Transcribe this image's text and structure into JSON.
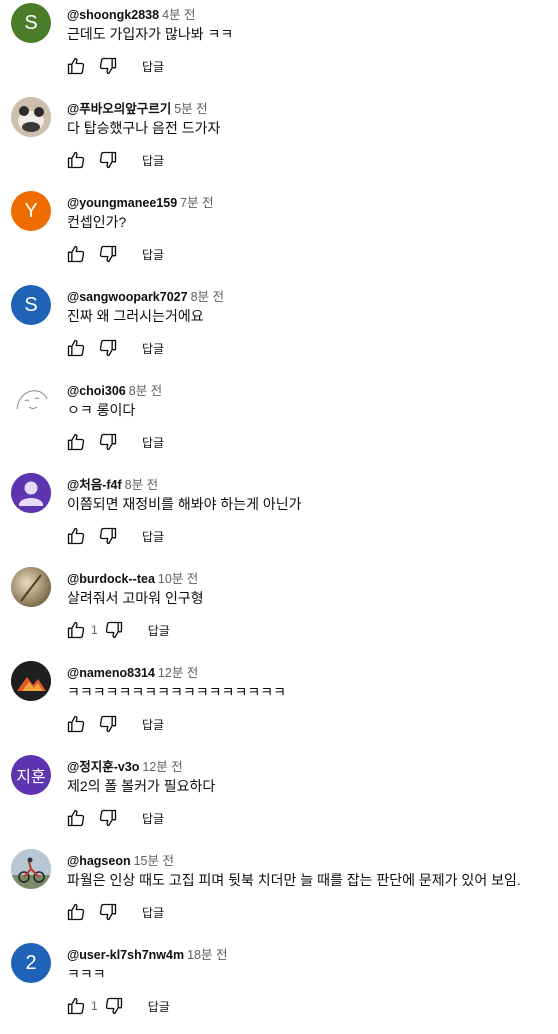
{
  "comments": [
    {
      "author": "@shoongk2838",
      "time": "4분 전",
      "text": "근데도 가입자가 많나봐 ㅋㅋ",
      "avatar": {
        "letter": "S",
        "color": "#4a7c2a",
        "kind": "letter"
      },
      "likes": "",
      "reply": "답글"
    },
    {
      "author": "@푸바오의앞구르기",
      "time": "5분 전",
      "text": "다 탑승했구나 음전 드가자",
      "avatar": {
        "letter": "",
        "color": "#bfb3a3",
        "kind": "photo-panda-icon"
      },
      "likes": "",
      "reply": "답글"
    },
    {
      "author": "@youngmanee159",
      "time": "7분 전",
      "text": "컨셉인가?",
      "avatar": {
        "letter": "Y",
        "color": "#ef6c00",
        "kind": "letter"
      },
      "likes": "",
      "reply": "답글"
    },
    {
      "author": "@sangwoopark7027",
      "time": "8분 전",
      "text": "진짜 왜 그러시는거에요",
      "avatar": {
        "letter": "S",
        "color": "#1e63b8",
        "kind": "letter"
      },
      "likes": "",
      "reply": "답글"
    },
    {
      "author": "@choi306",
      "time": "8분 전",
      "text": "ㅇㅋ 롱이다",
      "avatar": {
        "letter": "",
        "color": "#ffffff",
        "kind": "sketch-face-icon"
      },
      "likes": "",
      "reply": "답글"
    },
    {
      "author": "@처음-f4f",
      "time": "8분 전",
      "text": "이쯤되면 재정비를 해봐야 하는게 아닌가",
      "avatar": {
        "letter": "",
        "color": "#5e35b1",
        "kind": "default-user-icon"
      },
      "likes": "",
      "reply": "답글"
    },
    {
      "author": "@burdock--tea",
      "time": "10분 전",
      "text": "살려줘서 고마워 인구형",
      "avatar": {
        "letter": "",
        "color": "#a08b60",
        "kind": "photo-tea-icon"
      },
      "likes": "1",
      "reply": "답글"
    },
    {
      "author": "@nameno8314",
      "time": "12분 전",
      "text": "ㅋㅋㅋㅋㅋㅋㅋㅋㅋㅋㅋㅋㅋㅋㅋㅋㅋ",
      "avatar": {
        "letter": "",
        "color": "#222222",
        "kind": "mountain-logo-icon"
      },
      "likes": "",
      "reply": "답글"
    },
    {
      "author": "@정지훈-v3o",
      "time": "12분 전",
      "text": "제2의 폴 볼커가 필요하다",
      "avatar": {
        "letter": "지훈",
        "color": "#5e35b1",
        "kind": "letter"
      },
      "likes": "",
      "reply": "답글"
    },
    {
      "author": "@hagseon",
      "time": "15분 전",
      "text": "파월은 인상 때도 고집 피며 뒷북 치더만 늘 때를 잡는 판단에 문제가 있어 보임.",
      "avatar": {
        "letter": "",
        "color": "#8a9aa8",
        "kind": "photo-cyclist-icon"
      },
      "likes": "",
      "reply": "답글"
    },
    {
      "author": "@user-kl7sh7nw4m",
      "time": "18분 전",
      "text": "ㅋㅋㅋ",
      "avatar": {
        "letter": "2",
        "color": "#1e63b8",
        "kind": "letter"
      },
      "likes": "1",
      "reply": "답글"
    }
  ]
}
